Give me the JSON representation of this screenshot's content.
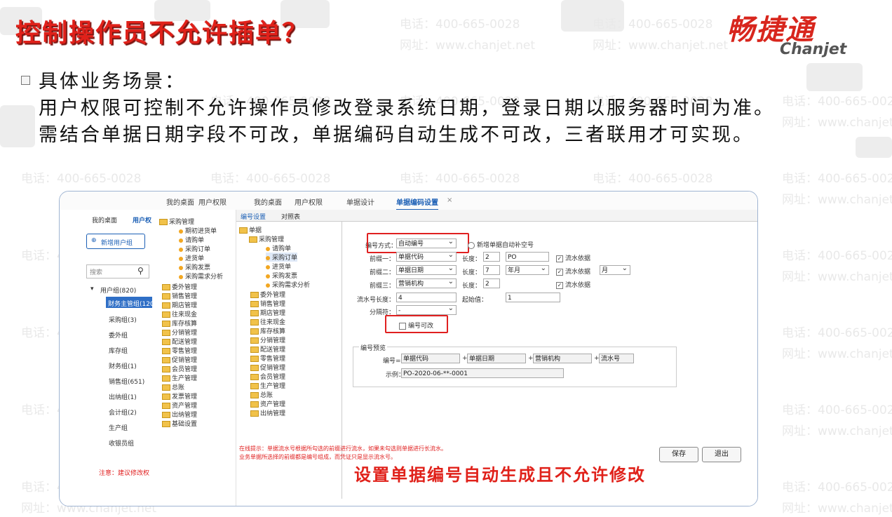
{
  "slide": {
    "title": "控制操作员不允许插单？",
    "logo_cn": "畅捷通",
    "logo_en": "Chanjet",
    "body_line1": "具体业务场景：",
    "body_line2": "用户权限可控制不允许操作员修改登录系统日期，登录日期以服务器时间为准。需结合单据日期字段不可改，单据编码自动生成不可改，三者联用才可实现。",
    "caption": "设置单据编号自动生成且不允许修改",
    "watermark_tel": "电话：400-665-0028",
    "watermark_url": "网址：www.chanjet.net"
  },
  "app": {
    "top_tabs": [
      "我的桌面",
      "用户权限",
      "我的桌面",
      "用户权限",
      "单据设计",
      "单据编码设置"
    ],
    "close_glyph": "×",
    "left": {
      "tabs": [
        "我的桌面",
        "用户权"
      ],
      "new_group_btn": "新增用户组",
      "search_placeholder": "搜索",
      "group_root": "用户组(820)",
      "selected_group": "财务主管组(120",
      "groups": [
        "采购组(3)",
        "委外组",
        "库存组",
        "财务组(1)",
        "销售组(651)",
        "出纳组(1)",
        "会计组(2)",
        "生产组",
        "收银员组"
      ],
      "note": "注意：建议修改权"
    },
    "tree1": {
      "root": "采购管理",
      "items": [
        "期初进货单",
        "请购单",
        "采购订单",
        "进货单",
        "采购发票",
        "采购需求分析"
      ],
      "folders": [
        "委外管理",
        "销售管理",
        "期店管理",
        "往来现金",
        "库存核算",
        "分销管理",
        "配送管理",
        "零售管理",
        "促销管理",
        "会员管理",
        "生产管理",
        "总账",
        "发票管理",
        "资产管理",
        "出纳管理",
        "基础设置"
      ]
    },
    "tree2": {
      "tabs": [
        "编号设置",
        "对照表"
      ],
      "root": "单据",
      "sub": "采购管理",
      "items": [
        "请购单",
        "采购订单",
        "进货单",
        "采购发票",
        "采购需求分析"
      ],
      "folders": [
        "委外管理",
        "销售管理",
        "期店管理",
        "往来现金",
        "库存核算",
        "分销管理",
        "配送管理",
        "零售管理",
        "促销管理",
        "会员管理",
        "生产管理",
        "总账",
        "资产管理",
        "出纳管理"
      ]
    },
    "form": {
      "mode_label": "编号方式：",
      "mode_value": "自动编号",
      "fill_empty_label": "新增单据自动补空号",
      "prefix_rows": [
        {
          "label": "前缀一：",
          "value": "单据代码",
          "len_label": "长度：",
          "len": "2",
          "extra": "PO",
          "chk": "流水依据"
        },
        {
          "label": "前缀二：",
          "value": "单据日期",
          "len_label": "长度：",
          "len": "7",
          "extra": "年月",
          "chk": "流水依据",
          "extra2": "月"
        },
        {
          "label": "前缀三：",
          "value": "营销机构",
          "len_label": "长度：",
          "len": "2",
          "extra": "",
          "chk": "流水依据"
        }
      ],
      "serial_len_label": "流水号长度：",
      "serial_len": "4",
      "start_label": "起始值：",
      "start": "1",
      "sep_label": "分隔符：",
      "sep": "-",
      "editable_label": "编号可改",
      "preview_title": "编号预览",
      "preview_label": "编号=",
      "preview_parts": [
        "单据代码",
        "单据日期",
        "营销机构",
        "流水号"
      ],
      "example_label": "示例：",
      "example": "PO-2020-06-**-0001",
      "hint1": "在线提示：单据流水号根据所勾选的前缀进行流水，如果未勾选则单据进行长流水。",
      "hint2": "业务单据所选择的前缀都是编号组成，而凭证只是显示流水号。",
      "save": "保存",
      "exit": "退出"
    }
  }
}
